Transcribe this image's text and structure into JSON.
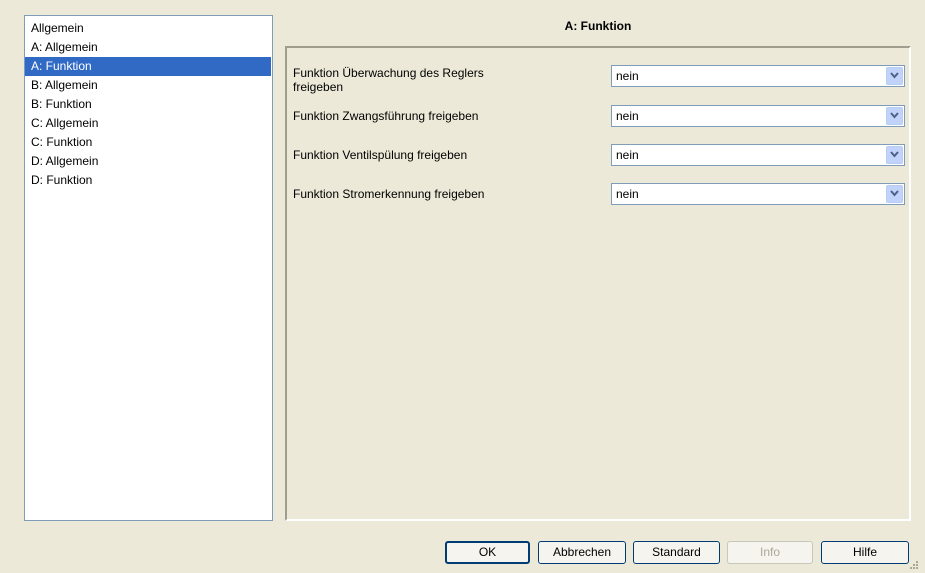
{
  "tree": {
    "items": [
      {
        "label": "Allgemein",
        "selected": false
      },
      {
        "label": "A: Allgemein",
        "selected": false
      },
      {
        "label": "A: Funktion",
        "selected": true
      },
      {
        "label": "B: Allgemein",
        "selected": false
      },
      {
        "label": "B: Funktion",
        "selected": false
      },
      {
        "label": "C: Allgemein",
        "selected": false
      },
      {
        "label": "C: Funktion",
        "selected": false
      },
      {
        "label": "D: Allgemein",
        "selected": false
      },
      {
        "label": "D: Funktion",
        "selected": false
      }
    ]
  },
  "page": {
    "title": "A: Funktion",
    "params": [
      {
        "label": "Funktion Überwachung des Reglers freigeben",
        "value": "nein"
      },
      {
        "label": "Funktion Zwangsführung freigeben",
        "value": "nein"
      },
      {
        "label": "Funktion Ventilspülung freigeben",
        "value": "nein"
      },
      {
        "label": "Funktion Stromerkennung freigeben",
        "value": "nein"
      }
    ]
  },
  "buttons": {
    "ok": "OK",
    "cancel": "Abbrechen",
    "standard": "Standard",
    "info": "Info",
    "help": "Hilfe"
  },
  "colors": {
    "selection": "#316ac5",
    "dialog_background": "#ece9d8",
    "combo_button": "#c1d3fb"
  },
  "icons": {
    "combo_arrow": "chevron-down-icon",
    "resize": "resize-grip-icon"
  }
}
